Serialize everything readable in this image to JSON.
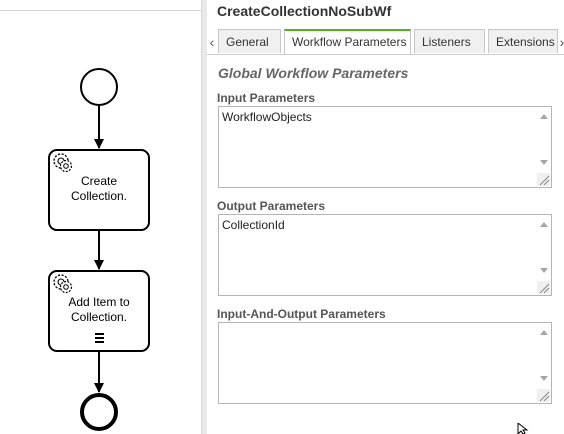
{
  "diagram": {
    "task1": {
      "label_line1": "Create",
      "label_line2": "Collection."
    },
    "task2": {
      "label_line1": "Add Item to",
      "label_line2": "Collection."
    }
  },
  "panel": {
    "title": "CreateCollectionNoSubWf",
    "tabs": [
      {
        "label": "General"
      },
      {
        "label": "Workflow Parameters"
      },
      {
        "label": "Listeners"
      },
      {
        "label": "Extensions"
      }
    ],
    "active_tab": "Workflow Parameters",
    "section_title": "Global Workflow Parameters",
    "input": {
      "label": "Input Parameters",
      "value": "WorkflowObjects"
    },
    "output": {
      "label": "Output Parameters",
      "value": "CollectionId"
    },
    "inout": {
      "label": "Input-And-Output Parameters",
      "value": ""
    }
  },
  "icons": [
    "gear-icon",
    "multi-instance-icon",
    "chevron-left-icon",
    "chevron-right-icon",
    "resize-grip-icon",
    "cursor-icon"
  ],
  "colors": {
    "active_tab_accent": "#52b415"
  }
}
